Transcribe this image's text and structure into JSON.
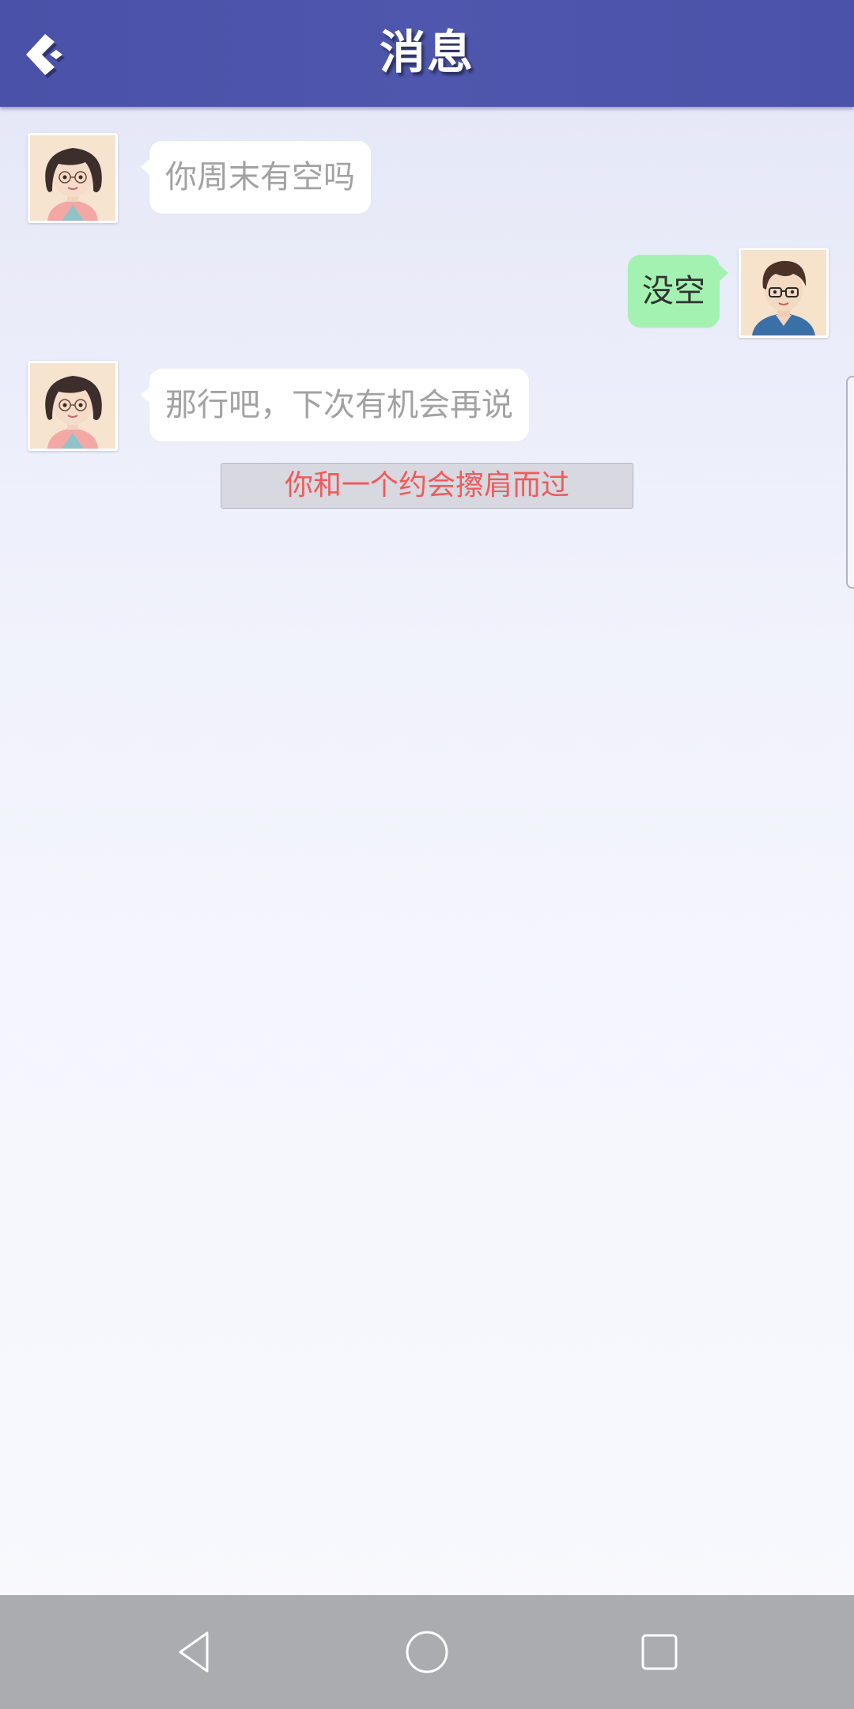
{
  "header": {
    "title": "消息",
    "back_icon": "back-chevron-icon"
  },
  "messages": [
    {
      "sender": "contact",
      "avatar": "girl-avatar",
      "text": "你周末有空吗"
    },
    {
      "sender": "self",
      "avatar": "boy-avatar",
      "text": "没空"
    },
    {
      "sender": "contact",
      "avatar": "girl-avatar",
      "text": "那行吧，下次有机会再说"
    }
  ],
  "system_notice": "你和一个约会擦肩而过",
  "navbar": {
    "back_icon": "nav-back-triangle-icon",
    "home_icon": "nav-home-circle-icon",
    "recents_icon": "nav-recents-square-icon"
  },
  "colors": {
    "header": "#4e56ad",
    "self_bubble": "#a4f2b2",
    "contact_bubble": "#ffffff",
    "notice_text": "#f05a5a",
    "navbar": "#abacb0"
  }
}
